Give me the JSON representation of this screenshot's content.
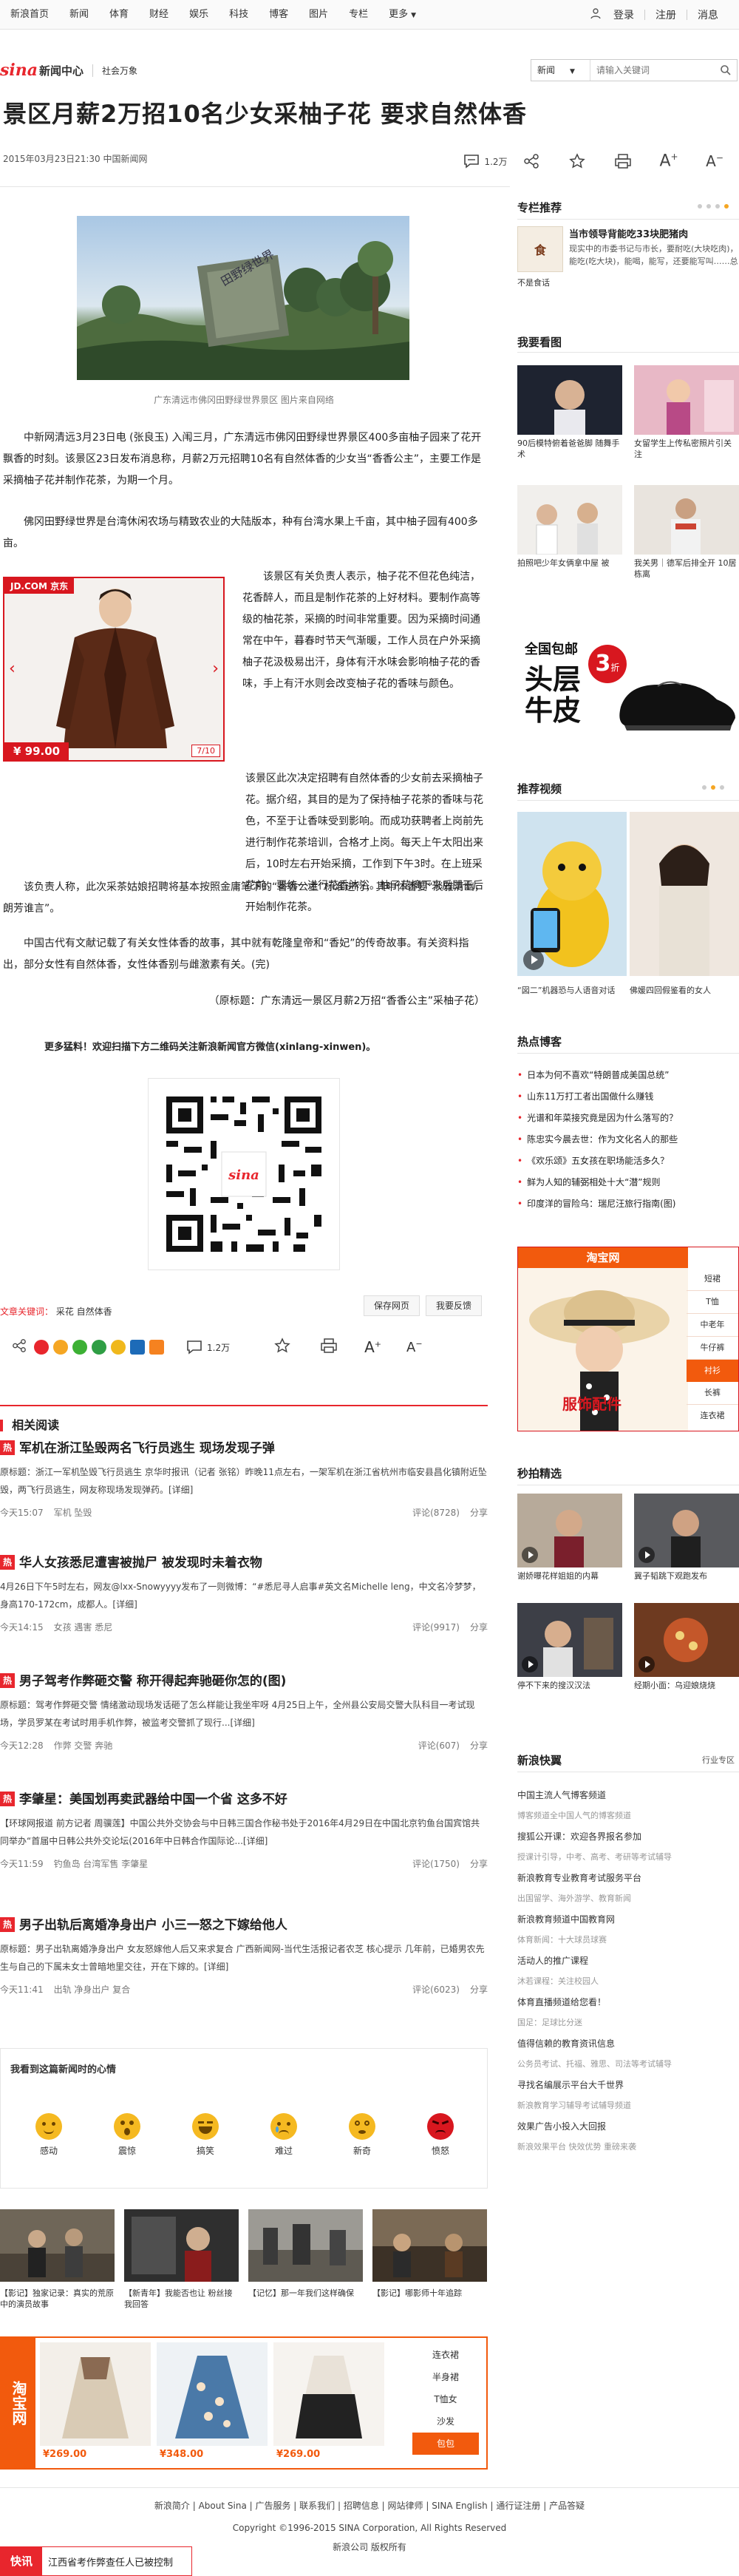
{
  "topnav": {
    "items": [
      "新浪首页",
      "新闻",
      "体育",
      "财经",
      "娱乐",
      "科技",
      "博客",
      "图片",
      "专栏",
      "更多"
    ],
    "login": "登录",
    "register": "注册",
    "messages": "消息"
  },
  "header": {
    "logo_text": "新闻中心",
    "logo_sub": "社会万象",
    "search_select": "新闻",
    "search_placeholder": "请输入关键词"
  },
  "article": {
    "title": "景区月薪2万招10名少女采柚子花 要求自然体香",
    "meta": "2015年03月23日21:30 中国新闻网",
    "comment_count": "1.2万",
    "image_caption": "广东清远市佛冈田野绿世界景区 图片来自网络",
    "paragraphs": [
      "中新网清远3月23日电 (张良玉) 入闱三月，广东清远市佛冈田野绿世界景区400多亩柚子园来了花开飘香的时刻。该景区23日发布消息称，月薪2万元招聘10名有自然体香的少女当“香香公主”，主要工作是采摘柚子花并制作花茶，为期一个月。",
      "佛冈田野绿世界是台湾休闲农场与精致农业的大陆版本，种有台湾水果上千亩，其中柚子园有400多亩。",
      "该景区有关负责人表示，柚子花不但花色纯洁，花香醉人，而且是制作花茶的上好材料。要制作高等级的柚花茶，采摘的时间非常重要。因为采摘时间通常在中午，暮春时节天气渐暖，工作人员在户外采摘柚子花汲极易出汗，身体有汗水味会影响柚子花的香味，手上有汗水则会改变柚子花的香味与颜色。",
      "该景区此次决定招聘有自然体香的少女前去采摘柚子花。据介绍，其目的是为了保持柚子花茶的香味与花色，不至于让香味受到影响。而成功获聘者上岗前先进行制作花茶培训，合格才上岗。每天上午太阳出来后，10时左右开始采摘，工作到下午3时。在上班采花前，要统一进行花香沐浴。柚子花摘下来后即干后开始制作花茶。",
      "该负责人称，此次采茶姑娘招聘将基本按照金庸笔下的“香香公主”标准进行，其中体香要“淡雅清幽，朗芳谁言”。",
      "中国古代有文献记载了有关女性体香的故事，其中就有乾隆皇帝和“香妃”的传奇故事。有关资料指出，部分女性有自然体香，女性体香别与雌激素有关。(完)",
      "（原标题：广东清远一景区月薪2万招“香香公主”采柚子花）"
    ],
    "qr_promo": "更多猛料！欢迎扫描下方二维码关注新浪新闻官方微信(xinlang-xinwen)。",
    "keywords_label": "文章关键词：",
    "keywords": "采花 自然体香",
    "save_btn": "保存网页",
    "feedback_btn": "我要反馈",
    "font_size_label": "1.2万"
  },
  "jd_ad": {
    "brand": "JD.COM 京东",
    "price": "¥ 99.00",
    "page": "7/10"
  },
  "sidebar": {
    "column_title": "专栏推荐",
    "column_headline": "当市领导背能吃33块肥猪肉",
    "column_text": "现实中的市委书记与市长，要耐吃(大块吃肉)，能吃(吃大块)，能喝，能写，还要能写叫……总",
    "column_badge": "不是食话",
    "pics_title": "我要看图",
    "pics": [
      {
        "caption": "90后模特俯着爸爸脚 随舞手术"
      },
      {
        "caption": "女留学生上传私密照片引关注"
      },
      {
        "caption": "拍照吧少年女俩拿中屋 被"
      },
      {
        "caption": "我关男｜德军后排全开 10居栋离"
      }
    ],
    "shoe_ad": {
      "line1": "全国包邮",
      "line2": "头层",
      "line3": "牛皮",
      "badge": "3",
      "badge_sub": "折"
    },
    "video_title": "推荐视频",
    "video_captions": [
      "“図二”机器恐与人语音对话",
      "佛媛四回假鉴看的女人"
    ],
    "hot_title": "热点博客",
    "hot_items": [
      "日本为何不喜欢“特朗普成美国总统”",
      "山东11万打工者出国做什么赚钱",
      "光谱和年菜接究竟是因为什么落写的？",
      "陈忠实今晨去世：作为文化名人的那些",
      "《欢乐颂》五女孩在职场能活多久？",
      "鲜为人知的辅弼相处十大“潜”规则",
      "印度洋的冒险乌：瑞尼汪旅行指南(图)"
    ],
    "taobao_brand": "淘宝网",
    "taobao_tabs": [
      "短裙",
      "T恤",
      "中老年",
      "牛仔裤",
      "衬衫",
      "长裤",
      "连衣裙"
    ],
    "taobao_slogan": "服饰配件",
    "secpick_title": "秒拍精选",
    "secpick": [
      {
        "caption": "谢娇曝花样姐姐的内幕"
      },
      {
        "caption": "冀子韬跳下观跑发布"
      },
      {
        "caption": "停不下来的搜汉汉法"
      },
      {
        "caption": "经期小面：乌迎娘烧烧"
      }
    ],
    "express_title": "新浪快翼",
    "express_sub": "行业专区",
    "express_list": [
      "中国主流人气博客频道",
      "博客频道全中国人气的博客频道",
      "搜狐公开课：欢迎各界报名参加",
      "授课计引导，中考、高考、考研等考试辅导",
      "新浪教育专业教育考试服务平台",
      "出国留学、海外游学、教育新闻",
      "新浪教育频道中国教育网",
      "体育新闻：十大球员球赛",
      "活动人的推广课程",
      "沐若课程：关注校园人",
      "体育直播频道给您看！",
      "国足：足球比分迷",
      "值得信赖的教育资讯信息",
      "公务员考试、托福、雅思、司法等考试辅导",
      "寻找名编展示平台大千世界",
      "新浪教育学习辅导考试辅导频道",
      "效果广告小投入大回报",
      "新浪效果平台 快效优势 重磅来袭"
    ]
  },
  "related": {
    "title": "相关阅读",
    "items": [
      {
        "badge": "热",
        "title": "军机在浙江坠毁两名飞行员逃生 现场发现子弹",
        "body": "原标题：浙江一军机坠毁飞行员逃生 京华时报讯（记者 张铭）昨晚11点左右，一架军机在浙江省杭州市临安县昌化镇附近坠毁，两飞行员逃生，网友称现场发现弹药。[详细]",
        "time": "今天15:07",
        "tags": "军机 坠毁",
        "comments": "评论(8728)",
        "share": "分享"
      },
      {
        "badge": "热",
        "title": "华人女孩悉尼遭害被抛尸 被发现时未着衣物",
        "body": "4月26日下午5时左右，网友@lxx-Snowyyyy发布了一则微博：“#悉尼寻人启事#英文名Michelle leng，中文名冷梦梦，身高170-172cm，成都人。[详细]",
        "time": "今天14:15",
        "tags": "女孩 遇害 悉尼",
        "comments": "评论(9917)",
        "share": "分享"
      },
      {
        "badge": "热",
        "title": "男子驾考作弊砸交警 称开得起奔驰砸你怎的(图)",
        "body": "原标题：驾考作弊砸交警 情绪激动现场发话砸了怎么样能让我坐牢呀 4月25日上午，全州县公安局交警大队科目一考试现场，学员罗某在考试时用手机作弊，被监考交警抓了现行...[详细]",
        "time": "今天12:28",
        "tags": "作弊 交警 奔驰",
        "comments": "评论(607)",
        "share": "分享"
      },
      {
        "badge": "热",
        "title": "李肇星：美国划再卖武器给中国一个省 这多不好",
        "body": "【环球网报道 前方记者 周骥莲】中国公共外交协会与中日韩三国合作秘书处于2016年4月29日在中国北京钓鱼台国宾馆共同举办“首届中日韩公共外交论坛(2016年中日韩合作国际论...[详细]",
        "time": "今天11:59",
        "tags": "钓鱼岛 台湾军售 李肇星",
        "comments": "评论(1750)",
        "share": "分享"
      },
      {
        "badge": "热",
        "title": "男子出轨后离婚净身出户 小三一怒之下嫁给他人",
        "body": "原标题：男子出轨离婚净身出户 女友怒嫁他人后又来求复合 广西新闻网-当代生活报记者农芝 核心提示 几年前，已婚男农先生与自己的下属未女士曾暗地里交往，开在下嫁的。[详细]",
        "time": "今天11:41",
        "tags": "出轨 净身出户 复合",
        "comments": "评论(6023)",
        "share": "分享"
      }
    ]
  },
  "mood": {
    "title": "我看到这篇新闻时的心情",
    "items": [
      {
        "label": "感动",
        "color": "#f5b921"
      },
      {
        "label": "震惊",
        "color": "#f5b921"
      },
      {
        "label": "搞笑",
        "color": "#f5b921"
      },
      {
        "label": "难过",
        "color": "#f5b921"
      },
      {
        "label": "新奇",
        "color": "#f5b921"
      },
      {
        "label": "愤怒",
        "color": "#d8171f"
      }
    ]
  },
  "bottom_pics": [
    {
      "caption": "【影记】独家记录：真实的荒原中的演员故事"
    },
    {
      "caption": "【新青年】我能否也让 粉丝接我回答"
    },
    {
      "caption": "【记忆】那一年我们这样确保"
    },
    {
      "caption": "【影记】哪影师十年追踪"
    }
  ],
  "taobao_bottom": {
    "brand": "淘宝网",
    "prices": [
      "¥269.00",
      "¥348.00",
      "¥269.00"
    ],
    "tabs": [
      "连衣裙",
      "半身裙",
      "T恤女",
      "沙发",
      "包包"
    ]
  },
  "footer": {
    "links": [
      "新浪简介",
      "About Sina",
      "广告服务",
      "联系我们",
      "招聘信息",
      "网站律师",
      "SINA English",
      "通行证注册",
      "产品答疑"
    ],
    "copyright": "Copyright ©1996-2015 SINA Corporation, All Rights Reserved",
    "company": "新浪公司 版权所有",
    "express_label": "快讯",
    "express_text": "江西省考作弊查任人已被控制"
  },
  "colors": {
    "brand_red": "#e8262d",
    "text": "#222222",
    "muted": "#777777"
  }
}
